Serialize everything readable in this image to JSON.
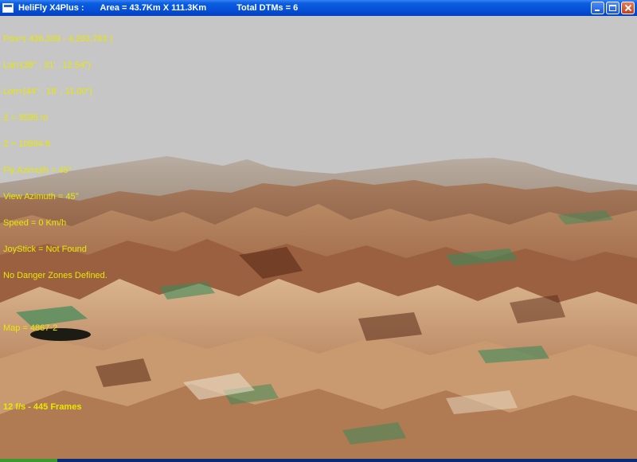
{
  "window": {
    "app_title": "HeliFly X4Plus :",
    "area": "Area = 43.7Km X 111.3Km",
    "total_dtms": "Total DTMs = 6"
  },
  "hud": {
    "pos": "Pos=( 436,339 - 4,263,783 )",
    "lat": "Lat=(38° , 31' , 12.54\")",
    "lon": "Lon=(44° , 18' , 11.00\")",
    "z_m": "Z = 3595 m",
    "z_ft": "Z = 10894 ft",
    "fly_azimuth": "Fly Azimuth = 45°",
    "view_azimuth": "View Azimuth = 45°",
    "speed": "Speed = 0 Km/h",
    "joystick": "JoyStick = Not Found",
    "danger_zones": "No Danger Zones Defined.",
    "map": "Map = 4867-2",
    "fps": "12 f/s - 445 Frames"
  },
  "colors": {
    "hud_text": "#e8e800",
    "sky": "#c6c6c6",
    "titlebar": "#0650d8"
  }
}
